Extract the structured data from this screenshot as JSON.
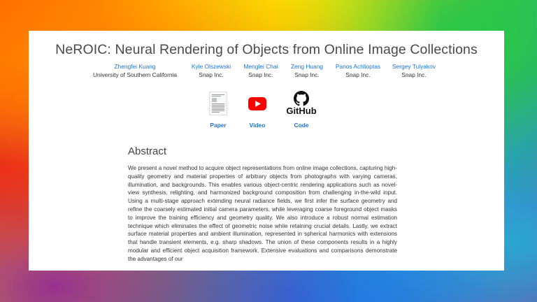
{
  "title": "NeROIC: Neural Rendering of Objects from Online Image Collections",
  "authors": [
    {
      "name": "Zhengfei Kuang",
      "affiliation": "University of Southern California"
    },
    {
      "name": "Kyle Olszewski",
      "affiliation": "Snap Inc."
    },
    {
      "name": "Menglei Chai",
      "affiliation": "Snap Inc."
    },
    {
      "name": "Zeng Huang",
      "affiliation": "Snap Inc."
    },
    {
      "name": "Panos Achlioptas",
      "affiliation": "Snap Inc."
    },
    {
      "name": "Sergey Tulyakov",
      "affiliation": "Snap Inc."
    }
  ],
  "links": {
    "paper": {
      "label": "Paper",
      "icon": "paper-thumbnail-icon"
    },
    "video": {
      "label": "Video",
      "icon": "youtube-icon",
      "color": "#ff0000"
    },
    "code": {
      "label": "Code",
      "icon": "github-icon",
      "logo_text": "GitHub"
    }
  },
  "abstract": {
    "heading": "Abstract",
    "text": "We present a novel method to acquire object representations from online image collections, capturing high-quality geometry and material properties of arbitrary objects from photographs with varying cameras, illumination, and backgrounds. This enables various object-centric rendering applications such as novel-view synthesis, relighting, and harmonized background composition from challenging in-the-wild input. Using a multi-stage approach extending neural radiance fields, we first infer the surface geometry and refine the coarsely estimated initial camera parameters, while leveraging coarse foreground object masks to improve the training efficiency and geometry quality. We also introduce a robust normal estimation technique which eliminates the effect of geometric noise while retaining crucial details. Lastly, we extract surface material properties and ambient illumination, represented in spherical harmonics with extensions that handle transient elements, e.g. sharp shadows. The union of these components results in a highly modular and efficient object acquisition framework. Extensive evaluations and comparisons demonstrate the advantages of our"
  },
  "colors": {
    "link": "#1a73d9",
    "text": "#333333",
    "title": "#4a4a4a"
  }
}
